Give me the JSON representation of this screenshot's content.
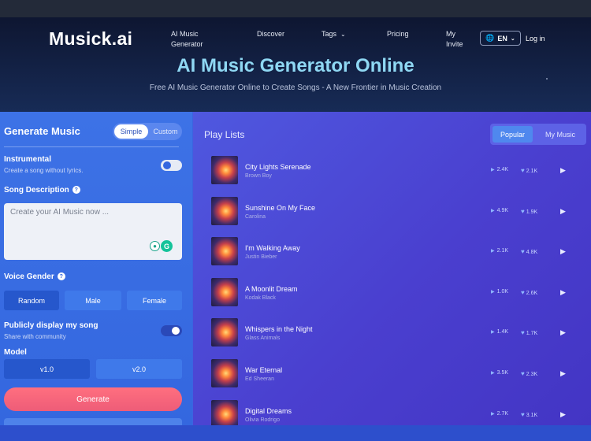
{
  "header": {
    "logo": "Musick.ai",
    "nav": {
      "ai_music_generator": "AI Music Generator",
      "discover": "Discover",
      "tags": "Tags",
      "pricing": "Pricing",
      "my_invite": "My Invite"
    },
    "language": "EN",
    "login": "Log in"
  },
  "hero": {
    "title": "AI Music Generator Online",
    "subtitle": "Free AI Music Generator Online to Create Songs - A New Frontier in Music Creation"
  },
  "generate": {
    "title": "Generate Music",
    "mode_simple": "Simple",
    "mode_custom": "Custom",
    "instrumental_label": "Instrumental",
    "instrumental_hint": "Create a song without lyrics.",
    "description_label": "Song Description",
    "description_placeholder": "Create your AI Music now ...",
    "voice_gender_label": "Voice Gender",
    "genders": [
      "Random",
      "Male",
      "Female"
    ],
    "public_label": "Publicly display my song",
    "public_hint": "Share with community",
    "model_label": "Model",
    "models": [
      "v1.0",
      "v2.0"
    ],
    "generate_button": "Generate"
  },
  "playlist": {
    "title": "Play Lists",
    "tab_popular": "Popular",
    "tab_my_music": "My Music",
    "tracks": [
      {
        "title": "City Lights Serenade",
        "artist": "Brown Boy",
        "plays": "2.4K",
        "likes": "2.1K"
      },
      {
        "title": "Sunshine On My Face",
        "artist": "Carolina",
        "plays": "4.9K",
        "likes": "1.9K"
      },
      {
        "title": "I'm Walking Away",
        "artist": "Justin Bieber",
        "plays": "2.1K",
        "likes": "4.8K"
      },
      {
        "title": "A Moonlit Dream",
        "artist": "Kodak Black",
        "plays": "1.0K",
        "likes": "2.6K"
      },
      {
        "title": "Whispers in the Night",
        "artist": "Glass Animals",
        "plays": "1.4K",
        "likes": "1.7K"
      },
      {
        "title": "War Eternal",
        "artist": "Ed Sheeran",
        "plays": "3.5K",
        "likes": "2.3K"
      },
      {
        "title": "Digital Dreams",
        "artist": "Olivia Rodrigo",
        "plays": "2.7K",
        "likes": "3.1K"
      }
    ]
  },
  "icons": {
    "globe": "globe-icon",
    "chevron": "chevron-down-icon",
    "help": "help-icon",
    "play": "play-icon",
    "heart": "heart-icon",
    "lightbulb": "lightbulb-icon",
    "grammarly": "grammarly-icon"
  },
  "colors": {
    "accent_generate": "#ee5c78",
    "hero_title": "#8fd8f3",
    "panel_left": "#3467df",
    "panel_right": "#4a3fcf"
  }
}
